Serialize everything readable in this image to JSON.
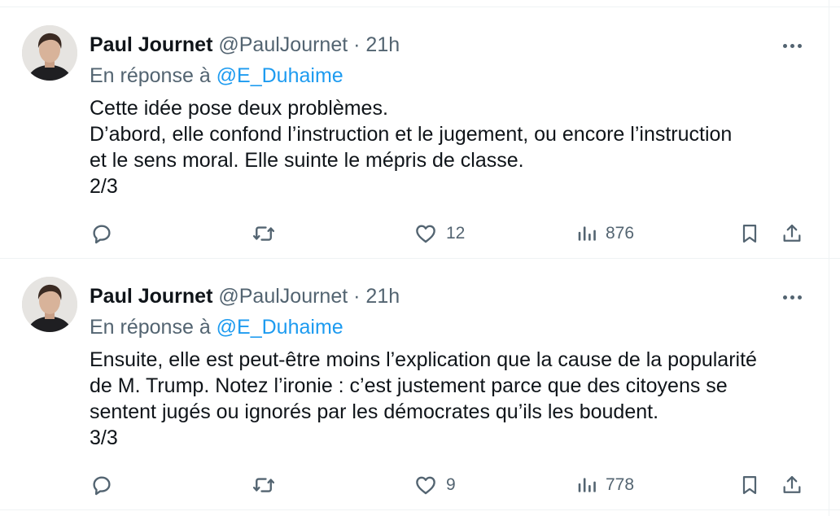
{
  "tweets": [
    {
      "author_name": "Paul Journet",
      "handle": "@PaulJournet",
      "separator": "·",
      "time": "21h",
      "reply_prefix": "En réponse à ",
      "reply_mention": "@E_Duhaime",
      "lines": [
        "Cette idée pose deux problèmes.",
        "D’abord, elle confond l’instruction et le jugement, ou encore l’instruction",
        "et le sens moral. Elle suinte le mépris de classe.",
        "2/3"
      ],
      "likes": "12",
      "views": "876"
    },
    {
      "author_name": "Paul Journet",
      "handle": "@PaulJournet",
      "separator": "·",
      "time": "21h",
      "reply_prefix": "En réponse à ",
      "reply_mention": "@E_Duhaime",
      "lines": [
        "Ensuite, elle est peut-être moins l’explication que la cause de la popularité",
        "de M. Trump. Notez l’ironie : c’est justement parce que des citoyens se",
        "sentent jugés ou ignorés par les démocrates qu’ils les boudent.",
        "3/3"
      ],
      "likes": "9",
      "views": "778"
    }
  ],
  "icons": {
    "reply": "speech-bubble-icon",
    "retweet": "retweet-icon",
    "like": "heart-icon",
    "views": "bar-chart-icon",
    "bookmark": "bookmark-icon",
    "share": "share-icon",
    "more": "more-icon"
  },
  "colors": {
    "text": "#0f1419",
    "secondary": "#536471",
    "link": "#1d9bf0",
    "divider": "#eff3f4"
  }
}
